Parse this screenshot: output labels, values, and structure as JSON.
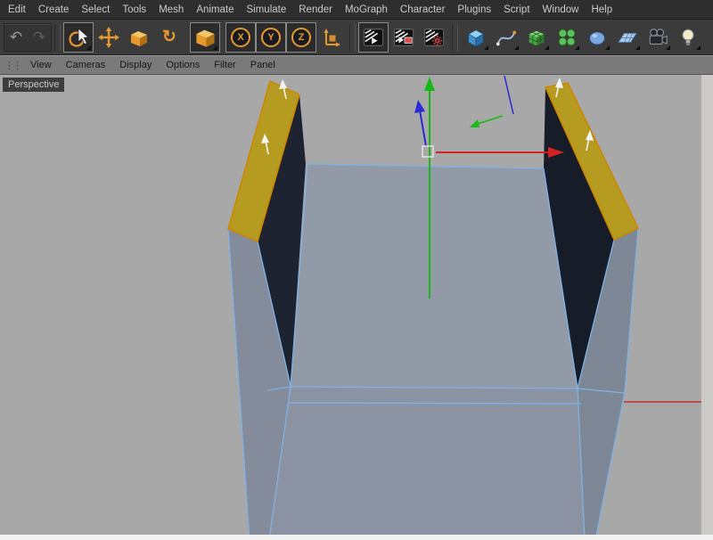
{
  "menu_bar": {
    "items": [
      "Edit",
      "Create",
      "Select",
      "Tools",
      "Mesh",
      "Animate",
      "Simulate",
      "Render",
      "MoGraph",
      "Character",
      "Plugins",
      "Script",
      "Window",
      "Help"
    ]
  },
  "toolbar": {
    "axis_buttons": [
      "X",
      "Y",
      "Z"
    ]
  },
  "viewport_menu": {
    "items": [
      "View",
      "Cameras",
      "Display",
      "Options",
      "Filter",
      "Panel"
    ]
  },
  "viewport": {
    "camera_label": "Perspective",
    "colors": {
      "background": "#a8a8a8",
      "model_top": "#929aa8",
      "model_front": "#8b93a2",
      "model_left": "#848c9b",
      "model_right": "#7e8795",
      "model_inner_left": "#1d2330",
      "model_inner_right": "#161c28",
      "selected_polygon": "#b59b20",
      "selected_polygon_edge": "#cf8500",
      "wireframe_edge": "#7fb2e6",
      "axis_x": "#d42222",
      "axis_y": "#18b818",
      "axis_z": "#2a2ad4",
      "world_x_line": "#c03030",
      "normal_arrow": "#f4f4f4",
      "accent_orange": "#e8992e"
    }
  }
}
